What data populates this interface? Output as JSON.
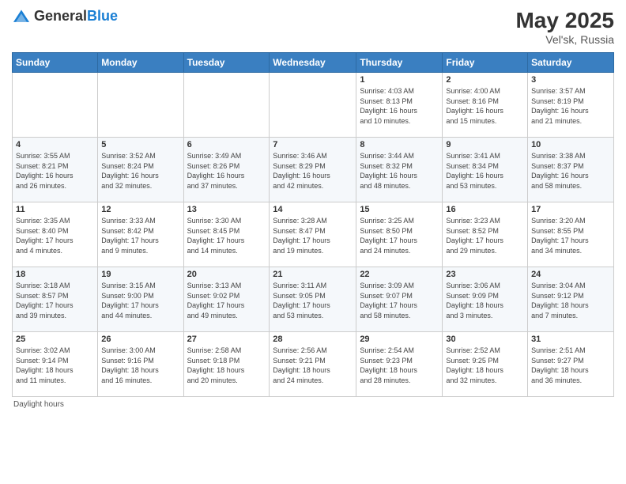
{
  "header": {
    "logo_general": "General",
    "logo_blue": "Blue",
    "month_year": "May 2025",
    "location": "Vel'sk, Russia"
  },
  "weekdays": [
    "Sunday",
    "Monday",
    "Tuesday",
    "Wednesday",
    "Thursday",
    "Friday",
    "Saturday"
  ],
  "weeks": [
    [
      {
        "day": "",
        "detail": ""
      },
      {
        "day": "",
        "detail": ""
      },
      {
        "day": "",
        "detail": ""
      },
      {
        "day": "",
        "detail": ""
      },
      {
        "day": "1",
        "detail": "Sunrise: 4:03 AM\nSunset: 8:13 PM\nDaylight: 16 hours\nand 10 minutes."
      },
      {
        "day": "2",
        "detail": "Sunrise: 4:00 AM\nSunset: 8:16 PM\nDaylight: 16 hours\nand 15 minutes."
      },
      {
        "day": "3",
        "detail": "Sunrise: 3:57 AM\nSunset: 8:19 PM\nDaylight: 16 hours\nand 21 minutes."
      }
    ],
    [
      {
        "day": "4",
        "detail": "Sunrise: 3:55 AM\nSunset: 8:21 PM\nDaylight: 16 hours\nand 26 minutes."
      },
      {
        "day": "5",
        "detail": "Sunrise: 3:52 AM\nSunset: 8:24 PM\nDaylight: 16 hours\nand 32 minutes."
      },
      {
        "day": "6",
        "detail": "Sunrise: 3:49 AM\nSunset: 8:26 PM\nDaylight: 16 hours\nand 37 minutes."
      },
      {
        "day": "7",
        "detail": "Sunrise: 3:46 AM\nSunset: 8:29 PM\nDaylight: 16 hours\nand 42 minutes."
      },
      {
        "day": "8",
        "detail": "Sunrise: 3:44 AM\nSunset: 8:32 PM\nDaylight: 16 hours\nand 48 minutes."
      },
      {
        "day": "9",
        "detail": "Sunrise: 3:41 AM\nSunset: 8:34 PM\nDaylight: 16 hours\nand 53 minutes."
      },
      {
        "day": "10",
        "detail": "Sunrise: 3:38 AM\nSunset: 8:37 PM\nDaylight: 16 hours\nand 58 minutes."
      }
    ],
    [
      {
        "day": "11",
        "detail": "Sunrise: 3:35 AM\nSunset: 8:40 PM\nDaylight: 17 hours\nand 4 minutes."
      },
      {
        "day": "12",
        "detail": "Sunrise: 3:33 AM\nSunset: 8:42 PM\nDaylight: 17 hours\nand 9 minutes."
      },
      {
        "day": "13",
        "detail": "Sunrise: 3:30 AM\nSunset: 8:45 PM\nDaylight: 17 hours\nand 14 minutes."
      },
      {
        "day": "14",
        "detail": "Sunrise: 3:28 AM\nSunset: 8:47 PM\nDaylight: 17 hours\nand 19 minutes."
      },
      {
        "day": "15",
        "detail": "Sunrise: 3:25 AM\nSunset: 8:50 PM\nDaylight: 17 hours\nand 24 minutes."
      },
      {
        "day": "16",
        "detail": "Sunrise: 3:23 AM\nSunset: 8:52 PM\nDaylight: 17 hours\nand 29 minutes."
      },
      {
        "day": "17",
        "detail": "Sunrise: 3:20 AM\nSunset: 8:55 PM\nDaylight: 17 hours\nand 34 minutes."
      }
    ],
    [
      {
        "day": "18",
        "detail": "Sunrise: 3:18 AM\nSunset: 8:57 PM\nDaylight: 17 hours\nand 39 minutes."
      },
      {
        "day": "19",
        "detail": "Sunrise: 3:15 AM\nSunset: 9:00 PM\nDaylight: 17 hours\nand 44 minutes."
      },
      {
        "day": "20",
        "detail": "Sunrise: 3:13 AM\nSunset: 9:02 PM\nDaylight: 17 hours\nand 49 minutes."
      },
      {
        "day": "21",
        "detail": "Sunrise: 3:11 AM\nSunset: 9:05 PM\nDaylight: 17 hours\nand 53 minutes."
      },
      {
        "day": "22",
        "detail": "Sunrise: 3:09 AM\nSunset: 9:07 PM\nDaylight: 17 hours\nand 58 minutes."
      },
      {
        "day": "23",
        "detail": "Sunrise: 3:06 AM\nSunset: 9:09 PM\nDaylight: 18 hours\nand 3 minutes."
      },
      {
        "day": "24",
        "detail": "Sunrise: 3:04 AM\nSunset: 9:12 PM\nDaylight: 18 hours\nand 7 minutes."
      }
    ],
    [
      {
        "day": "25",
        "detail": "Sunrise: 3:02 AM\nSunset: 9:14 PM\nDaylight: 18 hours\nand 11 minutes."
      },
      {
        "day": "26",
        "detail": "Sunrise: 3:00 AM\nSunset: 9:16 PM\nDaylight: 18 hours\nand 16 minutes."
      },
      {
        "day": "27",
        "detail": "Sunrise: 2:58 AM\nSunset: 9:18 PM\nDaylight: 18 hours\nand 20 minutes."
      },
      {
        "day": "28",
        "detail": "Sunrise: 2:56 AM\nSunset: 9:21 PM\nDaylight: 18 hours\nand 24 minutes."
      },
      {
        "day": "29",
        "detail": "Sunrise: 2:54 AM\nSunset: 9:23 PM\nDaylight: 18 hours\nand 28 minutes."
      },
      {
        "day": "30",
        "detail": "Sunrise: 2:52 AM\nSunset: 9:25 PM\nDaylight: 18 hours\nand 32 minutes."
      },
      {
        "day": "31",
        "detail": "Sunrise: 2:51 AM\nSunset: 9:27 PM\nDaylight: 18 hours\nand 36 minutes."
      }
    ]
  ],
  "footer": {
    "text": "Daylight hours"
  }
}
